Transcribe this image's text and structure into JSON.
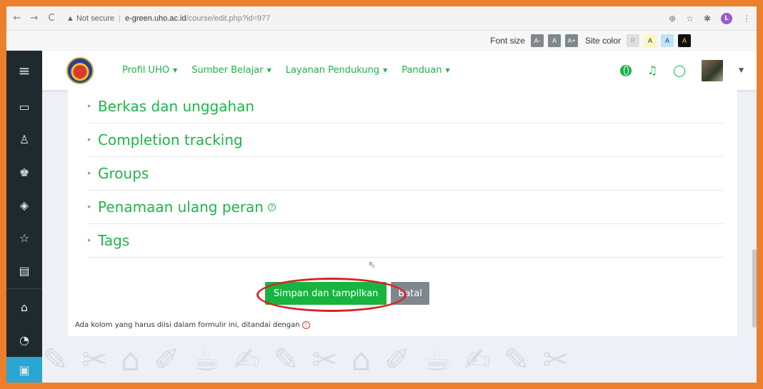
{
  "browser": {
    "warning": "▲ Not secure",
    "host": "e-green.uho.ac.id",
    "path": "/course/edit.php?id=977",
    "profile_initial": "L"
  },
  "accessibility": {
    "font_size_label": "Font size",
    "font_buttons": [
      "A-",
      "A",
      "A+"
    ],
    "site_color_label": "Site color",
    "color_buttons": [
      {
        "label": "R",
        "bg": "#e0e0e0",
        "fg": "#a0a0a0"
      },
      {
        "label": "A",
        "bg": "#fdf6c3",
        "fg": "#333333"
      },
      {
        "label": "A",
        "bg": "#bfe3f7",
        "fg": "#333333"
      },
      {
        "label": "A",
        "bg": "#111111",
        "fg": "#f5d60a"
      }
    ]
  },
  "navbar": {
    "menu": [
      "Profil UHO",
      "Sumber Belajar",
      "Layanan Pendukung",
      "Panduan"
    ]
  },
  "sections": [
    "Berkas dan unggahan",
    "Completion tracking",
    "Groups",
    "Penamaan ulang peran",
    "Tags"
  ],
  "form": {
    "save_label": "Simpan dan tampilkan",
    "cancel_label": "Batal",
    "required_note": "Ada kolom yang harus diisi dalam formulir ini, ditandai dengan"
  },
  "colors": {
    "accent_green": "#19b43f",
    "sidebar_bg": "#1f2a2e",
    "frame_orange": "#ec7f2b",
    "highlight_red": "#d8232a"
  }
}
